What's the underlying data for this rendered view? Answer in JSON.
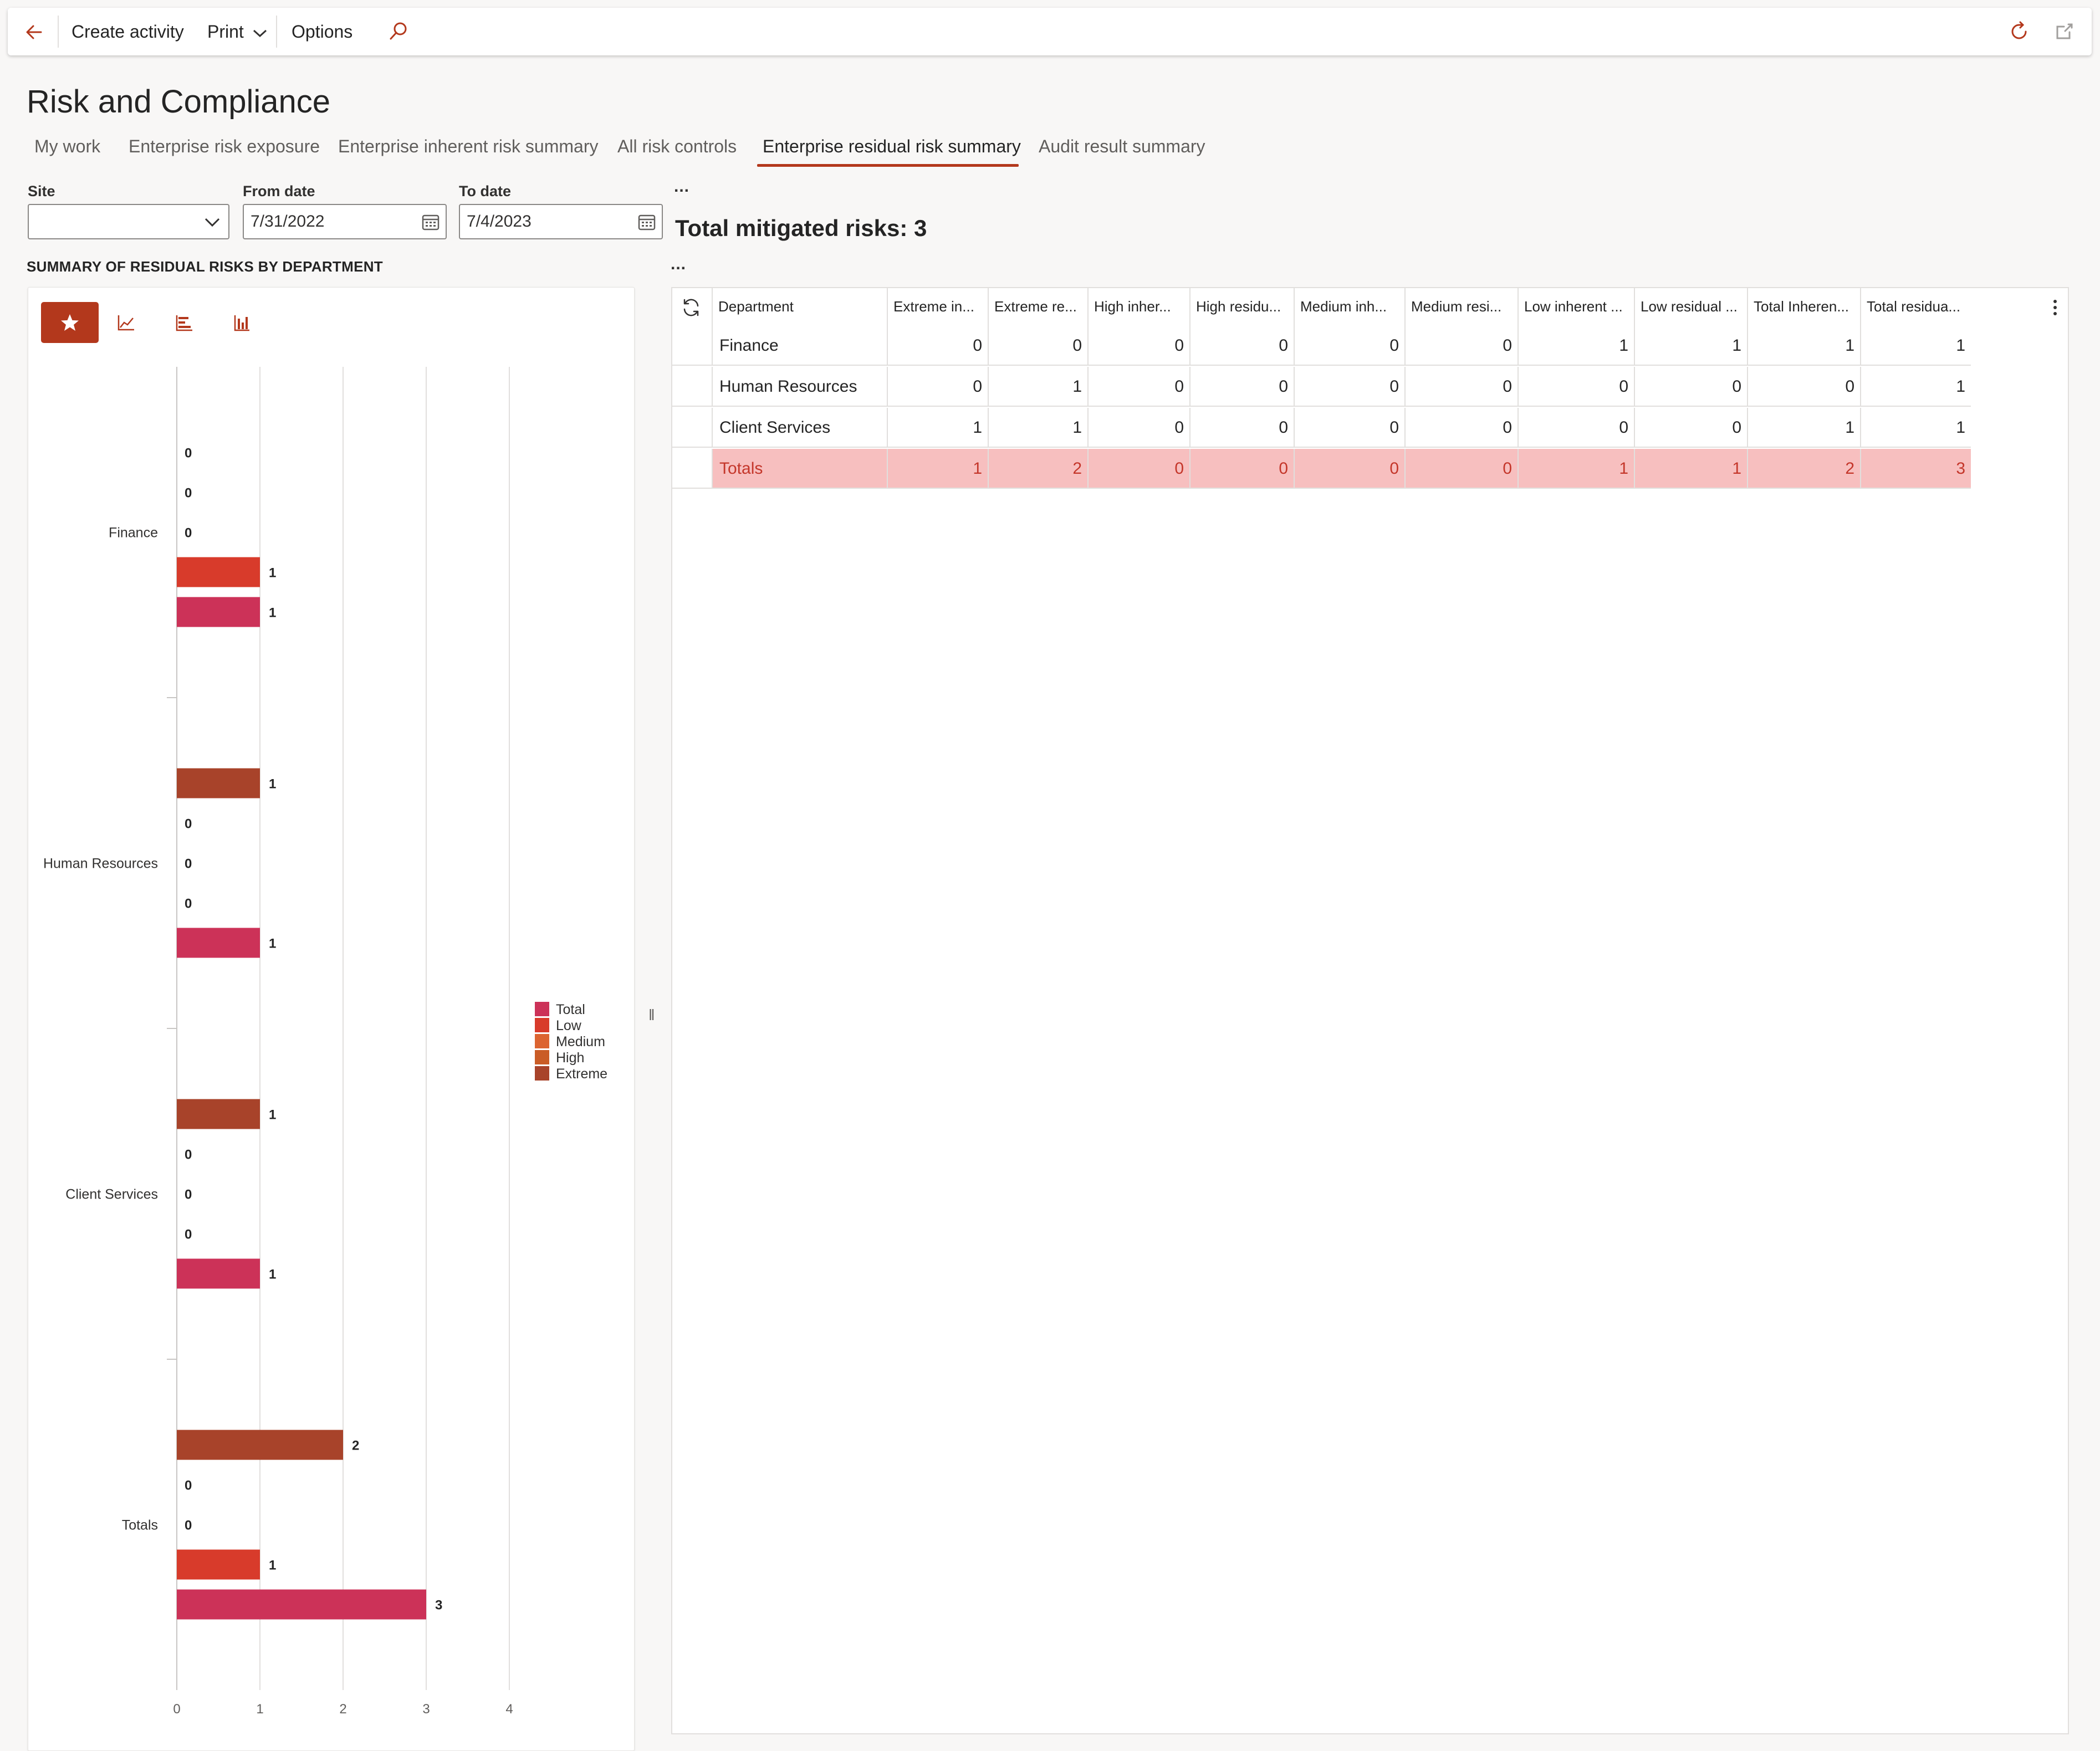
{
  "toolbar": {
    "create_activity": "Create activity",
    "print": "Print",
    "options": "Options"
  },
  "page": {
    "title": "Risk and Compliance"
  },
  "tabs": [
    {
      "label": "My work"
    },
    {
      "label": "Enterprise risk exposure"
    },
    {
      "label": "Enterprise inherent risk summary"
    },
    {
      "label": "All risk controls"
    },
    {
      "label": "Enterprise residual risk summary",
      "active": true
    },
    {
      "label": "Audit result summary"
    }
  ],
  "filters": {
    "site_label": "Site",
    "site_value": "",
    "from_label": "From date",
    "from_value": "7/31/2022",
    "to_label": "To date",
    "to_value": "7/4/2023"
  },
  "summary": {
    "ellipsis": "...",
    "total_mitigated": "Total mitigated risks: 3"
  },
  "chart": {
    "heading": "SUMMARY OF RESIDUAL RISKS BY DEPARTMENT"
  },
  "chart_data": {
    "type": "bar",
    "orientation": "horizontal",
    "title": "SUMMARY OF RESIDUAL RISKS BY DEPARTMENT",
    "categories": [
      "Finance",
      "Human Resources",
      "Client Services",
      "Totals"
    ],
    "series": [
      {
        "name": "Extreme",
        "color": "#a8432a",
        "values": [
          0,
          1,
          1,
          2
        ]
      },
      {
        "name": "High",
        "color": "#ca5c26",
        "values": [
          0,
          0,
          0,
          0
        ]
      },
      {
        "name": "Medium",
        "color": "#dc6431",
        "values": [
          0,
          0,
          0,
          0
        ]
      },
      {
        "name": "Low",
        "color": "#d83b2b",
        "values": [
          1,
          0,
          0,
          1
        ]
      },
      {
        "name": "Total",
        "color": "#cc3258",
        "values": [
          1,
          1,
          1,
          3
        ]
      }
    ],
    "legend_order": [
      "Total",
      "Low",
      "Medium",
      "High",
      "Extreme"
    ],
    "xlim": [
      0,
      4
    ],
    "xticks": [
      "0",
      "1",
      "2",
      "3",
      "4"
    ],
    "grid": true,
    "legend": "right"
  },
  "grid": {
    "columns": [
      "Department",
      "Extreme in...",
      "Extreme re...",
      "High inher...",
      "High residu...",
      "Medium inh...",
      "Medium resi...",
      "Low inherent ...",
      "Low residual ...",
      "Total Inheren...",
      "Total residua..."
    ],
    "rows": [
      {
        "dept": "Finance",
        "values": [
          "0",
          "0",
          "0",
          "0",
          "0",
          "0",
          "1",
          "1",
          "1",
          "1"
        ]
      },
      {
        "dept": "Human Resources",
        "values": [
          "0",
          "1",
          "0",
          "0",
          "0",
          "0",
          "0",
          "0",
          "0",
          "1"
        ]
      },
      {
        "dept": "Client Services",
        "values": [
          "1",
          "1",
          "0",
          "0",
          "0",
          "0",
          "0",
          "0",
          "1",
          "1"
        ]
      },
      {
        "dept": "Totals",
        "values": [
          "1",
          "2",
          "0",
          "0",
          "0",
          "0",
          "1",
          "1",
          "2",
          "3"
        ],
        "is_total": true
      }
    ]
  },
  "colors": {
    "accent": "#b3381c",
    "total_row_bg": "#f7bfbf",
    "total_row_text": "#c4362a"
  }
}
